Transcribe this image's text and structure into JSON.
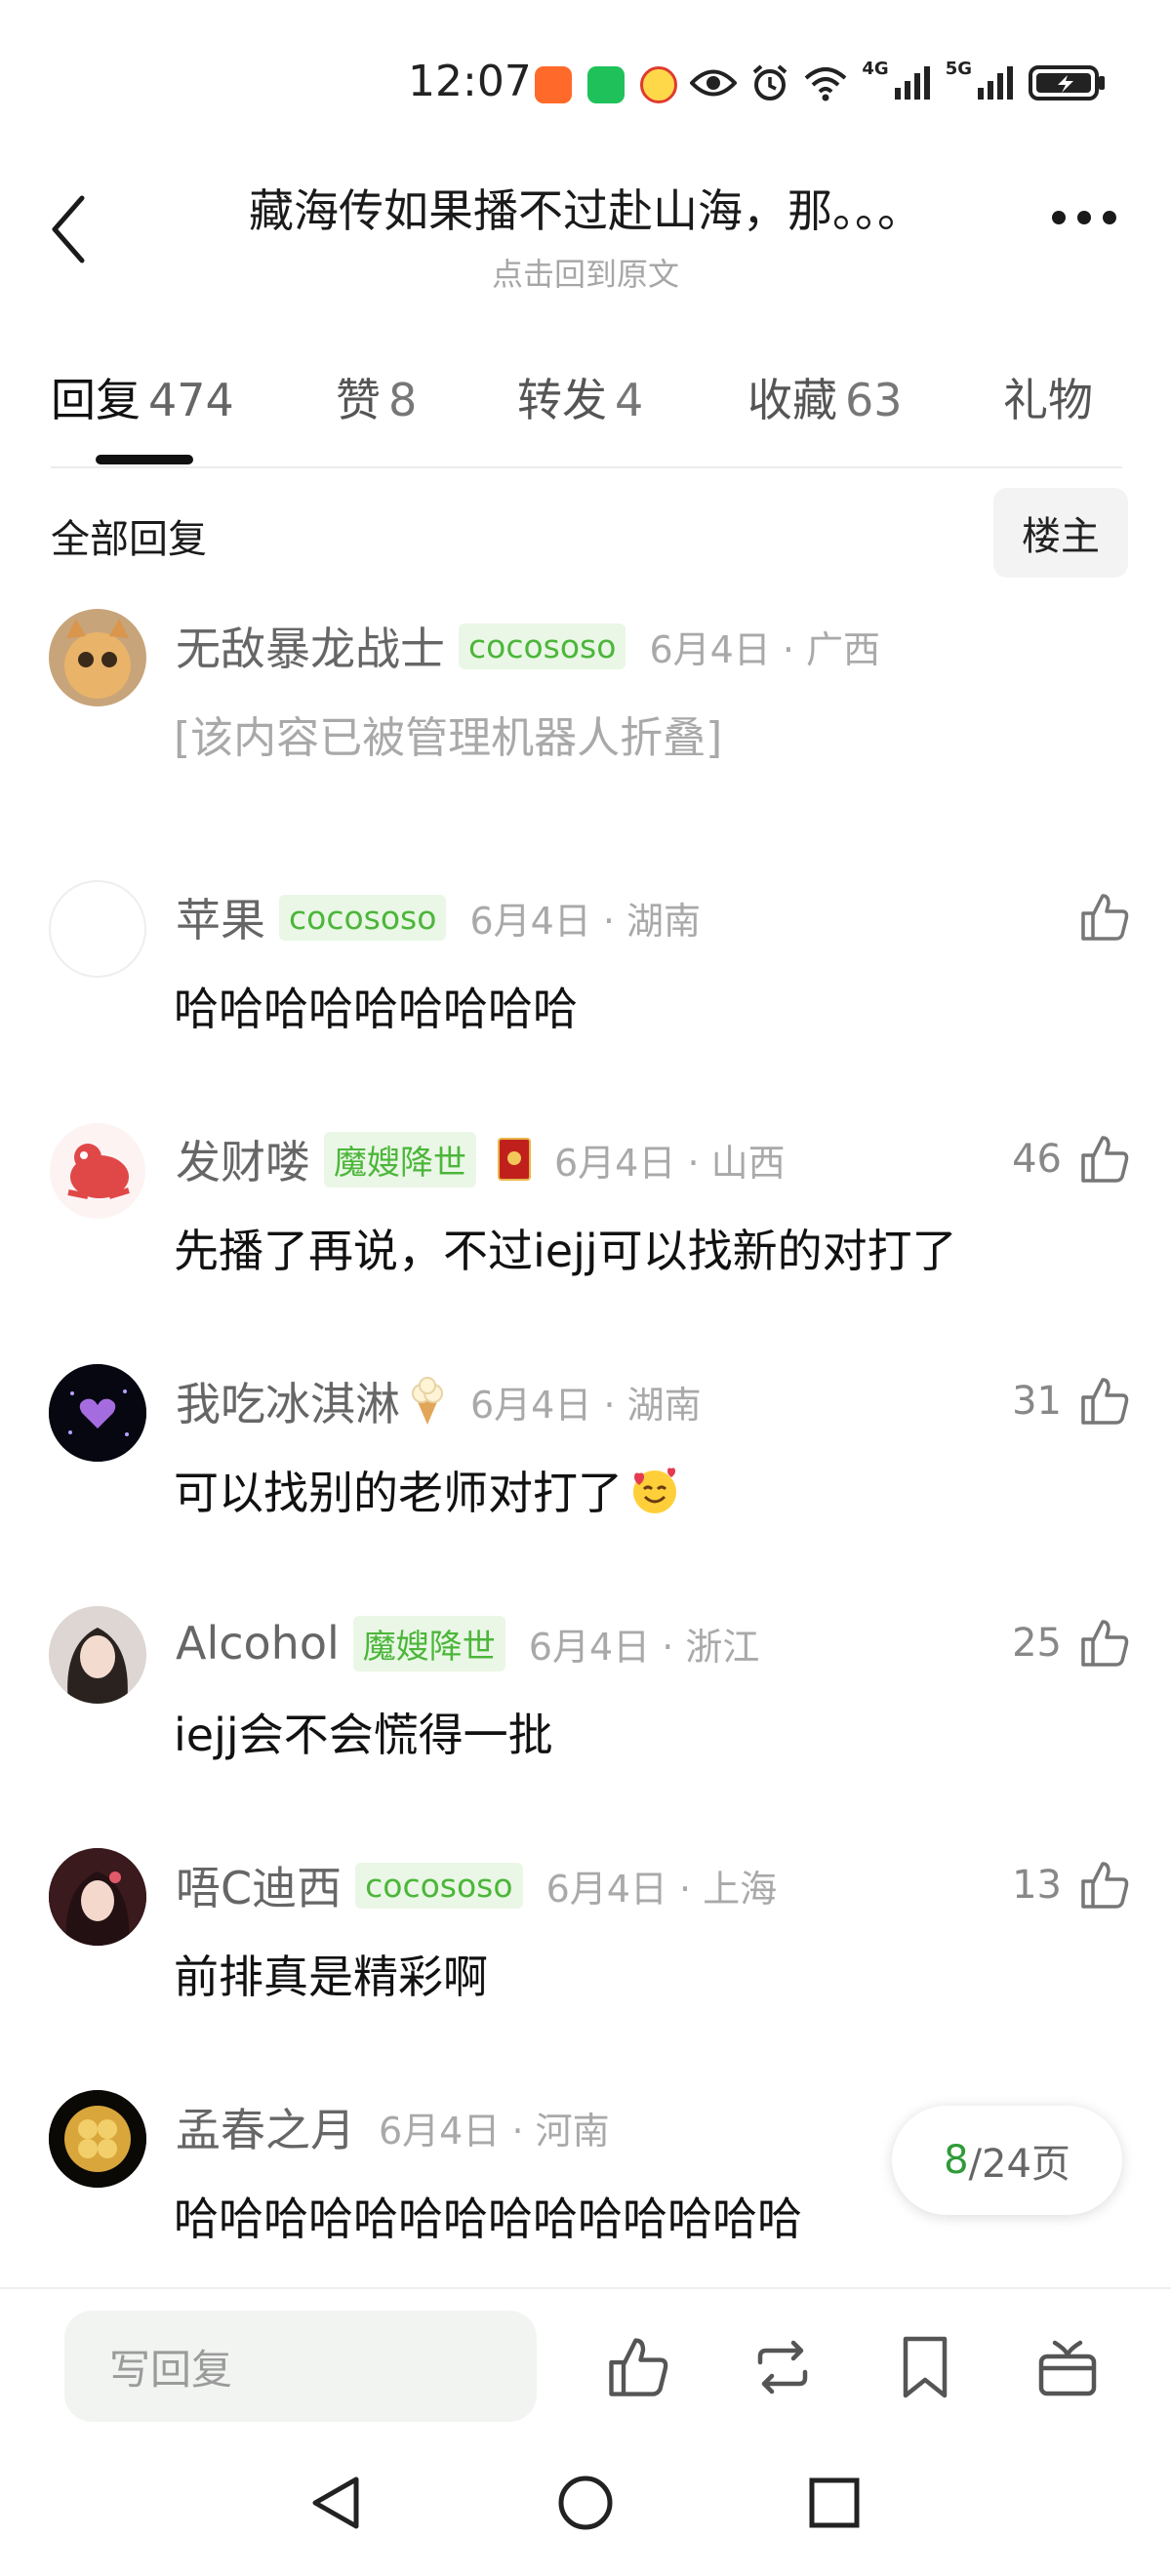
{
  "status_bar": {
    "time": "12:07",
    "network_1": "4G",
    "network_2": "5G",
    "icons": [
      "app-orange-icon",
      "wechat-icon",
      "weibo-icon",
      "eye-icon",
      "alarm-icon",
      "wifi-icon",
      "signal-4g-icon",
      "signal-5g-icon",
      "battery-charging-icon"
    ]
  },
  "header": {
    "title": "藏海传如果播不过赴山海，那。。。",
    "subtitle": "点击回到原文"
  },
  "tabs": [
    {
      "label": "回复",
      "count": "474",
      "active": true
    },
    {
      "label": "赞",
      "count": "8"
    },
    {
      "label": "转发",
      "count": "4"
    },
    {
      "label": "收藏",
      "count": "63"
    },
    {
      "label": "礼物",
      "count": ""
    }
  ],
  "filter": {
    "all_replies": "全部回复",
    "owner_only": "楼主"
  },
  "comments": [
    {
      "username": "无敌暴龙战士",
      "badge": "cocososo",
      "date": "6月4日",
      "location": "广西",
      "likes": "",
      "content": "[该内容已被管理机器人折叠]",
      "folded": true
    },
    {
      "username": "苹果",
      "badge": "cocososo",
      "date": "6月4日",
      "location": "湖南",
      "likes": "",
      "content": "哈哈哈哈哈哈哈哈哈"
    },
    {
      "username": "发财喽",
      "badge": "魔嫂降世",
      "date": "6月4日",
      "location": "山西",
      "likes": "46",
      "content": "先播了再说，不过iejj可以找新的对打了"
    },
    {
      "username": "我吃冰淇淋",
      "badge": "",
      "date": "6月4日",
      "location": "湖南",
      "likes": "31",
      "content": "可以找别的老师对打了"
    },
    {
      "username": "Alcohol",
      "badge": "魔嫂降世",
      "date": "6月4日",
      "location": "浙江",
      "likes": "25",
      "content": "iejj会不会慌得一批"
    },
    {
      "username": "唔C迪西",
      "badge": "cocososo",
      "date": "6月4日",
      "location": "上海",
      "likes": "13",
      "content": "前排真是精彩啊"
    },
    {
      "username": "孟春之月",
      "badge": "",
      "date": "6月4日",
      "location": "河南",
      "likes": "",
      "content": "哈哈哈哈哈哈哈哈哈哈哈哈哈哈"
    }
  ],
  "pagination": {
    "current": "8",
    "total_label": "/24页"
  },
  "bottom_bar": {
    "reply_placeholder": "写回复"
  },
  "colors": {
    "accent_green": "#4cb63a",
    "page_green": "#2f9a38",
    "badge_bg": "#eaf7e6"
  }
}
